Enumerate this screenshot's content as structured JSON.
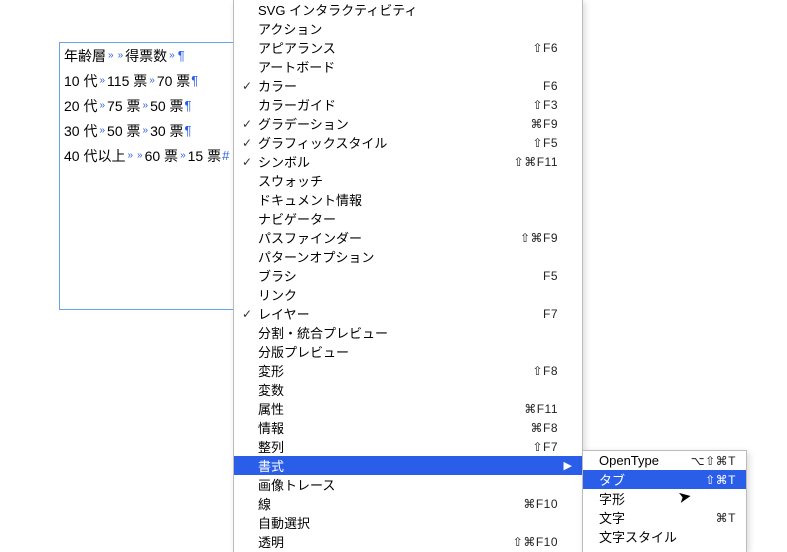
{
  "textframe": {
    "rows": [
      {
        "cells": [
          "年齢層",
          "",
          "得票数",
          ""
        ],
        "end": "para"
      },
      {
        "cells": [
          "10 代",
          "115 票",
          "70 票"
        ],
        "end": "para"
      },
      {
        "cells": [
          "20 代",
          "75 票",
          "50 票"
        ],
        "end": "para"
      },
      {
        "cells": [
          "30 代",
          "50 票",
          "30 票"
        ],
        "end": "para"
      },
      {
        "cells": [
          "40 代以上",
          "",
          "60 票",
          "15 票"
        ],
        "end": "hash"
      }
    ]
  },
  "menu1": [
    {
      "label": "SVG インタラクティビティ"
    },
    {
      "label": "アクション"
    },
    {
      "label": "アピアランス",
      "sc": "⇧F6"
    },
    {
      "label": "アートボード"
    },
    {
      "label": "カラー",
      "chk": "✓",
      "sc": "F6"
    },
    {
      "label": "カラーガイド",
      "sc": "⇧F3"
    },
    {
      "label": "グラデーション",
      "chk": "✓",
      "sc": "⌘F9"
    },
    {
      "label": "グラフィックスタイル",
      "chk": "✓",
      "sc": "⇧F5"
    },
    {
      "label": "シンボル",
      "chk": "✓",
      "sc": "⇧⌘F11"
    },
    {
      "label": "スウォッチ"
    },
    {
      "label": "ドキュメント情報"
    },
    {
      "label": "ナビゲーター"
    },
    {
      "label": "パスファインダー",
      "sc": "⇧⌘F9"
    },
    {
      "label": "パターンオプション"
    },
    {
      "label": "ブラシ",
      "sc": "F5"
    },
    {
      "label": "リンク"
    },
    {
      "label": "レイヤー",
      "chk": "✓",
      "sc": "F7"
    },
    {
      "label": "分割・統合プレビュー"
    },
    {
      "label": "分版プレビュー"
    },
    {
      "label": "変形",
      "sc": "⇧F8"
    },
    {
      "label": "変数"
    },
    {
      "label": "属性",
      "sc": "⌘F11"
    },
    {
      "label": "情報",
      "sc": "⌘F8"
    },
    {
      "label": "整列",
      "sc": "⇧F7"
    },
    {
      "label": "書式",
      "sub": true,
      "sel": true
    },
    {
      "label": "画像トレース"
    },
    {
      "label": "線",
      "sc": "⌘F10"
    },
    {
      "label": "自動選択"
    },
    {
      "label": "透明",
      "sc": "⇧⌘F10"
    }
  ],
  "menu2": [
    {
      "label": "OpenType",
      "sc": "⌥⇧⌘T"
    },
    {
      "label": "タブ",
      "sc": "⇧⌘T",
      "sel": true
    },
    {
      "label": "字形"
    },
    {
      "label": "文字",
      "sc": "⌘T"
    },
    {
      "label": "文字スタイル"
    }
  ]
}
